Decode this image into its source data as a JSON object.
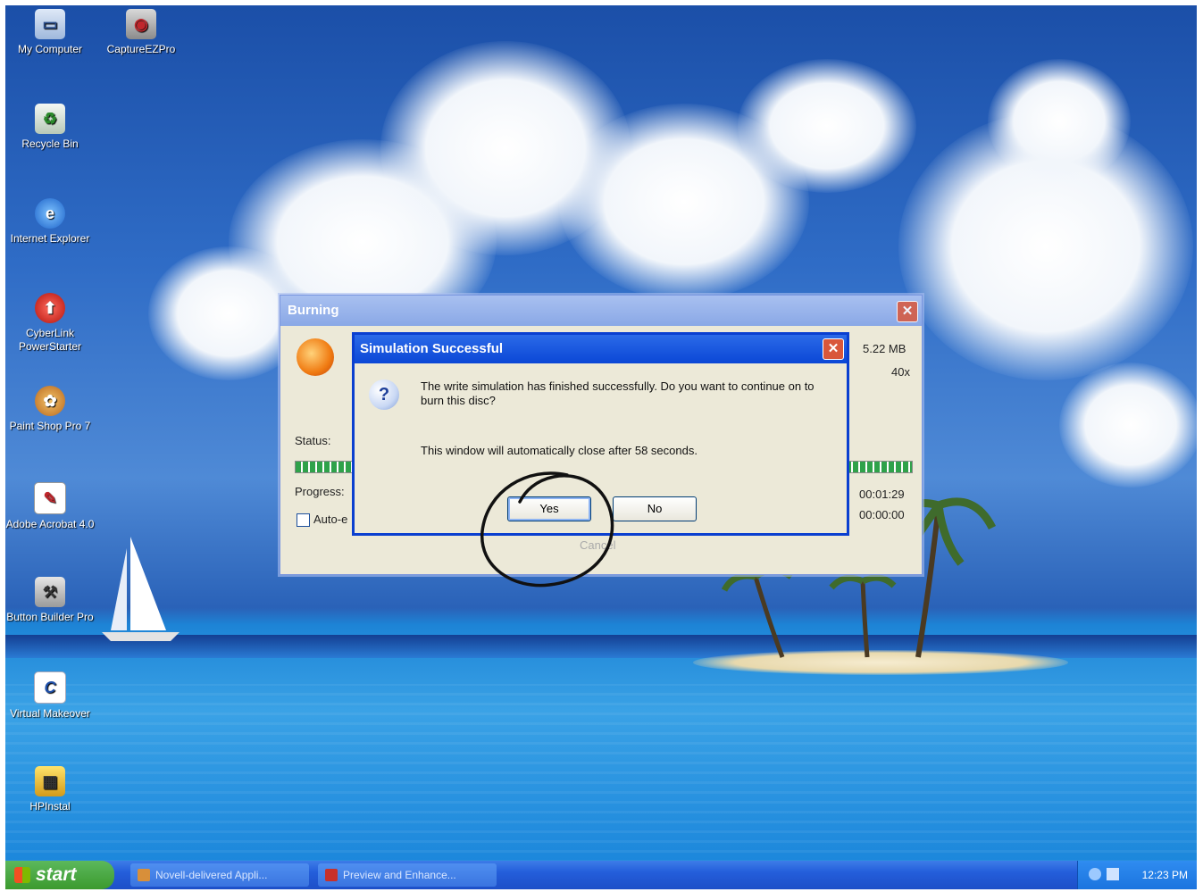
{
  "desktop": {
    "icons": [
      {
        "label": "My Computer"
      },
      {
        "label": "CaptureEZPro"
      },
      {
        "label": "Recycle Bin"
      },
      {
        "label": "Internet Explorer"
      },
      {
        "label": "CyberLink PowerStarter"
      },
      {
        "label": "Paint Shop Pro 7"
      },
      {
        "label": "Adobe Acrobat 4.0"
      },
      {
        "label": "Button Builder Pro"
      },
      {
        "label": "Virtual Makeover"
      },
      {
        "label": "HPInstal"
      }
    ]
  },
  "burning_window": {
    "title": "Burning",
    "close_glyph": "✕",
    "status_label": "Status:",
    "progress_label": "Progress:",
    "auto_label": "Auto-e",
    "size_value": "5.22 MB",
    "speed_value": "40x",
    "elapsed_time": "00:01:29",
    "remaining_time": "00:00:00",
    "cancel_label": "Cancel"
  },
  "dialog": {
    "title": "Simulation Successful",
    "close_glyph": "✕",
    "message": "The write simulation has finished successfully. Do you want to continue on to burn this disc?",
    "auto_close_message": "This window will automatically close after 58 seconds.",
    "yes_label": "Yes",
    "no_label": "No",
    "question_glyph": "?"
  },
  "taskbar": {
    "start_label": "start",
    "tasks": [
      {
        "label": "Novell-delivered Appli..."
      },
      {
        "label": "Preview and Enhance..."
      }
    ],
    "clock": "12:23 PM"
  }
}
